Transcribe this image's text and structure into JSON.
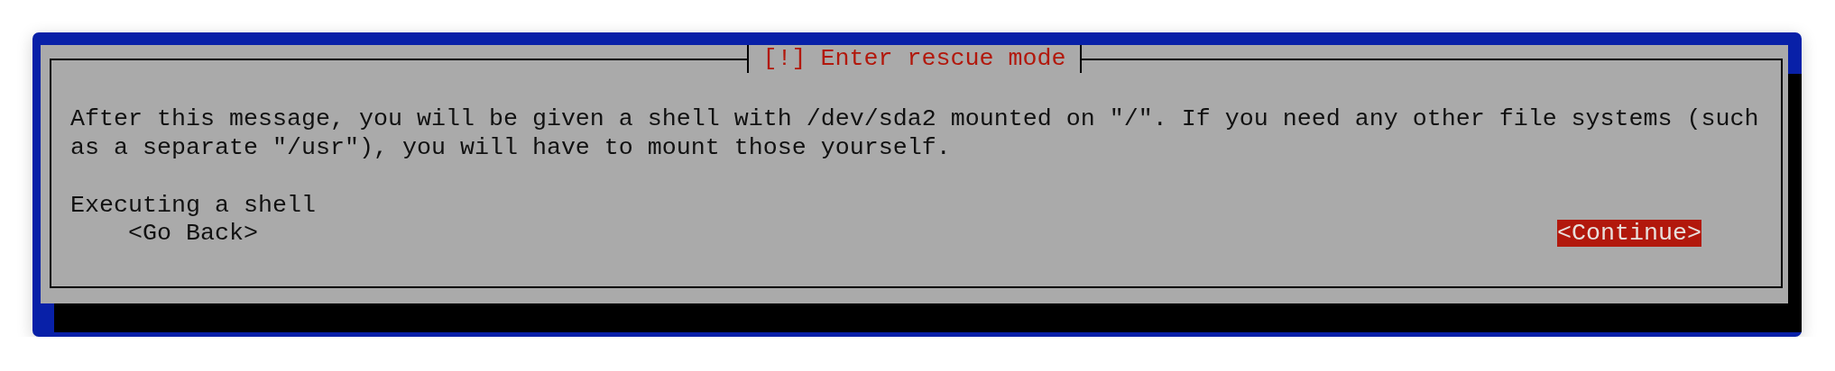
{
  "dialog": {
    "title": "[!] Enter rescue mode",
    "message": "After this message, you will be given a shell with /dev/sda2 mounted on \"/\". If you need any other file systems (such as a separate \"/usr\"), you will have to mount those yourself.",
    "status": "Executing a shell",
    "buttons": [
      {
        "label": "<Go Back>",
        "selected": false
      },
      {
        "label": "<Continue>",
        "selected": true
      }
    ]
  }
}
